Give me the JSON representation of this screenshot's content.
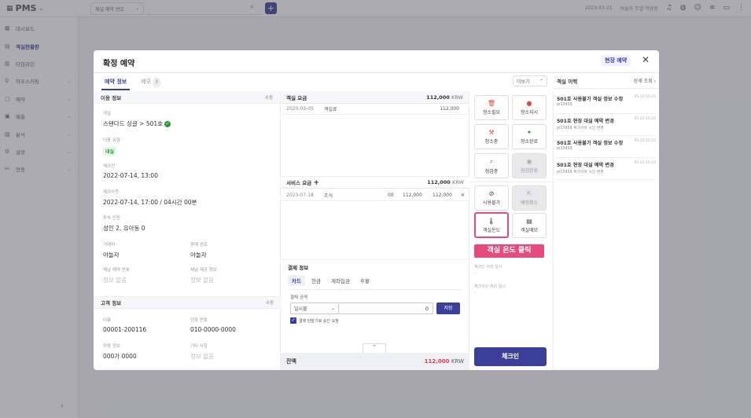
{
  "app": {
    "logo": "PMS",
    "search_select": "채널 예약 번호",
    "top_right": {
      "date": "2023-03-21",
      "hotel": "아놀자 무엘 역삼점"
    }
  },
  "sidebar": {
    "items": [
      {
        "label": "대시보드",
        "icon": "grid-icon",
        "chevron": false
      },
      {
        "label": "객실현황판",
        "icon": "calendar-icon",
        "chevron": false,
        "active": true
      },
      {
        "label": "타임라인",
        "icon": "timeline-icon",
        "chevron": false
      },
      {
        "label": "하우스키핑",
        "icon": "broom-icon",
        "chevron": true
      },
      {
        "label": "예약",
        "icon": "book-icon",
        "chevron": true
      },
      {
        "label": "매출",
        "icon": "money-icon",
        "chevron": true
      },
      {
        "label": "분석",
        "icon": "chart-icon",
        "chevron": true
      },
      {
        "label": "설정",
        "icon": "gear-icon",
        "chevron": true
      },
      {
        "label": "연동",
        "icon": "link-icon",
        "chevron": true
      }
    ]
  },
  "modal": {
    "title": "확정 예약",
    "badge": "현장 예약",
    "tabs": [
      {
        "label": "예약 정보",
        "active": true
      },
      {
        "label": "메모",
        "count": "3"
      }
    ],
    "more_label": "더보기",
    "stay_section": {
      "title": "이용 정보",
      "edit": "수정",
      "room_label": "객실",
      "room_value": "스탠다드 싱글 > 501호",
      "usage_label": "이용 유형",
      "usage_value": "대실",
      "checkin_label": "체크인",
      "checkin_value": "2022-07-14, 13:00",
      "checkout_label": "체크아웃",
      "checkout_value": "2022-07-14, 17:00 / 04시간 00분",
      "guests_label": "투숙 인원",
      "guests_value": "성인 2, 유아동 0",
      "channel_label": "거래처",
      "channel_value": "야놀자",
      "sales_label": "판매 경로",
      "sales_value": "야놀자",
      "channel_no_label": "채널 예약 번호",
      "channel_no_value": "정보 없음",
      "sales_info_label": "채널 제공 정보",
      "sales_info_value": "정보 없음"
    },
    "guest_section": {
      "title": "고객 정보",
      "edit": "수정",
      "name_label": "이름",
      "name_value": "00001-200116",
      "phone_label": "전화 번호",
      "phone_value": "010-0000-0000",
      "car_label": "차량 정보",
      "car_value": "000가 0000",
      "etc_label": "기타 사항",
      "etc_value": "정보 없음"
    },
    "room_fee": {
      "title": "객실 요금",
      "amount": "112,000",
      "unit": "KRW",
      "rows": [
        {
          "date": "2020-03-05",
          "item": "객실료",
          "amount": "112,000"
        }
      ]
    },
    "service_fee": {
      "title": "서비스 요금",
      "add": "+",
      "amount": "112,000",
      "unit": "KRW",
      "rows": [
        {
          "date": "2023-07-18",
          "item": "조식",
          "qty": "00",
          "price": "112,000",
          "total": "112,000",
          "remove": "✕"
        }
      ]
    },
    "payment": {
      "title": "결제 정보",
      "tabs": [
        {
          "label": "카드",
          "active": true
        },
        {
          "label": "현금"
        },
        {
          "label": "계좌입금"
        },
        {
          "label": "후불"
        }
      ],
      "amount_label": "결제 금액",
      "card_select": "일시불",
      "amount_value": "0",
      "submit": "저장",
      "checkbox_label": "결제 단말기로 승인 요청"
    },
    "balance": {
      "label": "잔액",
      "amount": "112,000",
      "unit": "KRW"
    },
    "actions": [
      {
        "label": "청소필요",
        "icon": "trash-icon",
        "color": "#e34a3b"
      },
      {
        "label": "청소지시",
        "icon": "alert-icon",
        "color": "#e34a3b"
      },
      {
        "label": "청소중",
        "icon": "broom-icon",
        "color": "#e34a3b"
      },
      {
        "label": "청소완료",
        "icon": "sparkle-icon",
        "color": "#2b9a3b"
      },
      {
        "label": "점검중",
        "icon": "magnifier-icon",
        "color": "#2b9a3b"
      },
      {
        "label": "점검완료",
        "icon": "check-circle-icon",
        "color": "#aaaaaa",
        "disabled": true
      },
      {
        "label": "사용불가",
        "icon": "ban-icon",
        "color": "#444444"
      },
      {
        "label": "배정취소",
        "icon": "unassign-icon",
        "color": "#aaaaaa",
        "disabled": true
      },
      {
        "label": "객실온도",
        "icon": "thermometer-icon",
        "color": "#444444",
        "highlight": true
      },
      {
        "label": "객실메모",
        "icon": "memo-icon",
        "color": "#444444"
      }
    ],
    "callout": "객실 온도 클릭",
    "act_fields": [
      {
        "label": "체크인 처리 일시"
      },
      {
        "label": "체크아웃 처리 일시"
      }
    ],
    "checkin_button": "체크인",
    "history": {
      "title": "객실 이력",
      "link": "상세 조회",
      "items": [
        {
          "title": "501호 사용불가 객실 정보 수정",
          "time": "05-22 15:23",
          "sub": "pi13456"
        },
        {
          "title": "501호 현장 대실 예약 변경",
          "time": "05-22 15:23",
          "sub": "pi13456  체크아웃 시간 변경"
        },
        {
          "title": "501호 사용불가 객실 정보 수정",
          "time": "05-22 15:23",
          "sub": "pi13456"
        },
        {
          "title": "501호 현장 대실 예약 변경",
          "time": "05-22 15:23",
          "sub": "pi13456  체크아웃 시간 변경"
        }
      ]
    }
  }
}
